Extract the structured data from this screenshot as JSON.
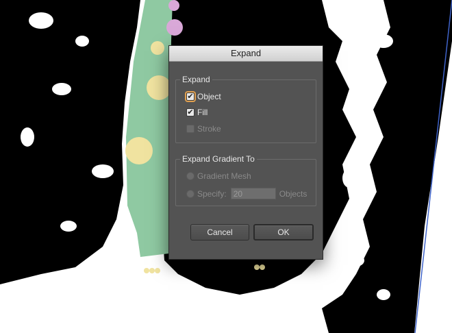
{
  "dialog": {
    "title": "Expand",
    "expand_group": {
      "legend": "Expand",
      "object": {
        "label": "Object",
        "checked": true,
        "focused": true
      },
      "fill": {
        "label": "Fill",
        "checked": true
      },
      "stroke": {
        "label": "Stroke",
        "checked": false,
        "disabled": true
      }
    },
    "gradient_group": {
      "legend": "Expand Gradient To",
      "gradient_mesh": {
        "label": "Gradient Mesh",
        "disabled": true
      },
      "specify": {
        "label": "Specify:",
        "value": "20",
        "suffix": "Objects",
        "disabled": true
      }
    },
    "buttons": {
      "cancel": "Cancel",
      "ok": "OK"
    }
  },
  "colors": {
    "dialog_bg": "#535353",
    "focus_ring": "#e0a050",
    "artwork_green": "#8fc9a2",
    "artwork_yellow": "#f0e3a0",
    "artwork_pink": "#d9a8d8",
    "guide_blue": "#3f63c9"
  },
  "icons": {
    "checkmark": "checkmark-icon"
  }
}
